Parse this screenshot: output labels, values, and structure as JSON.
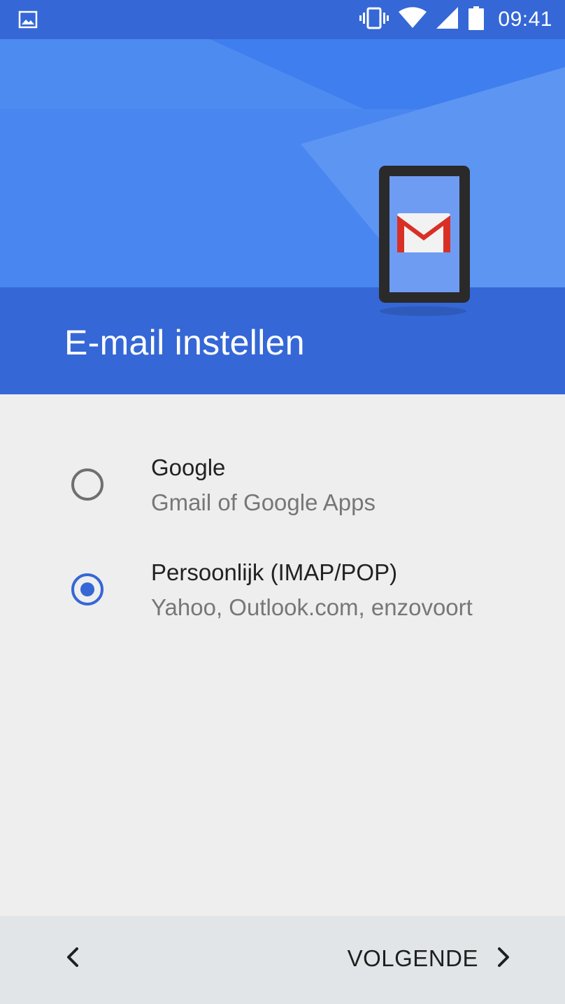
{
  "status_bar": {
    "time": "09:41",
    "icons": [
      "image-notification-icon",
      "vibrate-icon",
      "wifi-icon",
      "cell-signal-icon",
      "battery-icon"
    ]
  },
  "header": {
    "title": "E-mail instellen",
    "illustration": "phone-with-gmail-icon"
  },
  "options": [
    {
      "title": "Google",
      "subtitle": "Gmail of Google Apps",
      "selected": false
    },
    {
      "title": "Persoonlijk (IMAP/POP)",
      "subtitle": "Yahoo, Outlook.com, enzovoort",
      "selected": true
    }
  ],
  "footer": {
    "next_label": "VOLGENDE"
  },
  "colors": {
    "status_bar": "#3567d6",
    "header_light": "#4a86f0",
    "header_band": "#3567d6",
    "accent": "#3567d6",
    "background": "#eeeeee",
    "footer": "#e2e5e8"
  }
}
